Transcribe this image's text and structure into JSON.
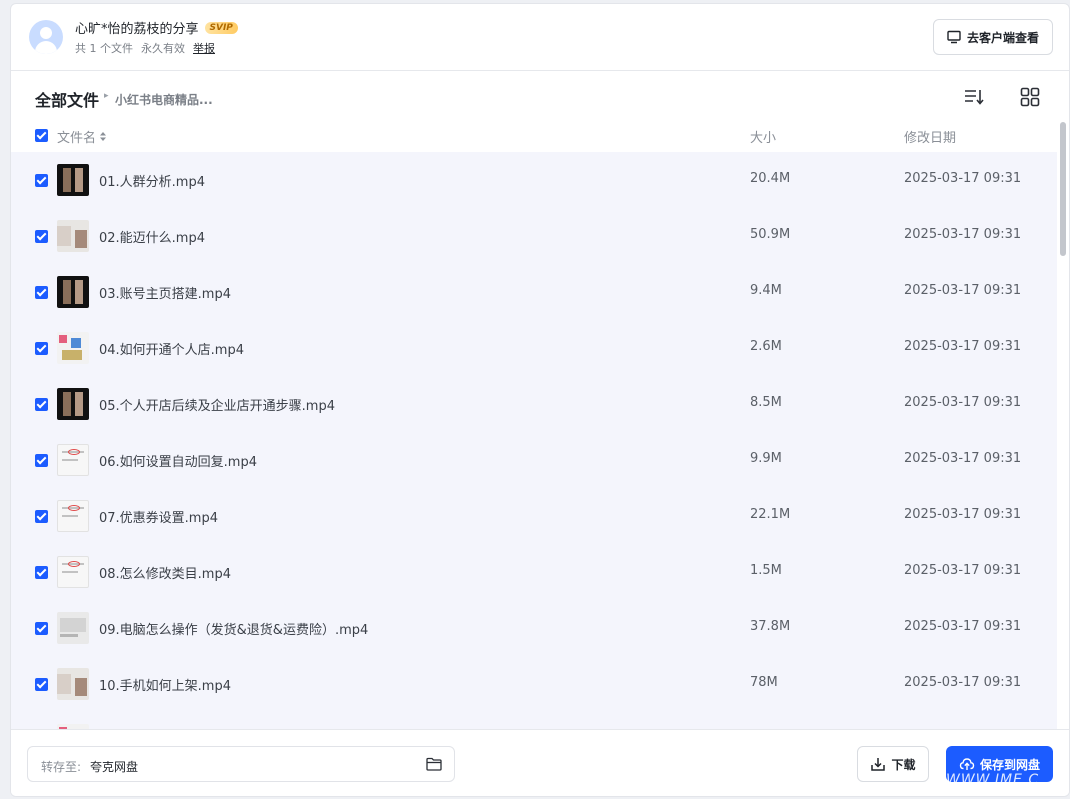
{
  "header": {
    "sharer_name": "心旷*怡的荔枝的分享",
    "vip_badge": "SVIP",
    "file_count": "共 1 个文件",
    "validity": "永久有效",
    "report_label": "举报",
    "client_button_label": "去客户端查看"
  },
  "breadcrumb": {
    "root": "全部文件",
    "current": "小红书电商精品..."
  },
  "table": {
    "columns": {
      "name": "文件名",
      "size": "大小",
      "date": "修改日期"
    },
    "rows": [
      {
        "name": "01.人群分析.mp4",
        "size": "20.4M",
        "date": "2025-03-17 09:31",
        "thumb": "t-dark"
      },
      {
        "name": "02.能迈什么.mp4",
        "size": "50.9M",
        "date": "2025-03-17 09:31",
        "thumb": "t-light"
      },
      {
        "name": "03.账号主页搭建.mp4",
        "size": "9.4M",
        "date": "2025-03-17 09:31",
        "thumb": "t-dark"
      },
      {
        "name": "04.如何开通个人店.mp4",
        "size": "2.6M",
        "date": "2025-03-17 09:31",
        "thumb": "t-mix"
      },
      {
        "name": "05.个人开店后续及企业店开通步骤.mp4",
        "size": "8.5M",
        "date": "2025-03-17 09:31",
        "thumb": "t-dark"
      },
      {
        "name": "06.如何设置自动回复.mp4",
        "size": "9.9M",
        "date": "2025-03-17 09:31",
        "thumb": "t-doc"
      },
      {
        "name": "07.优惠券设置.mp4",
        "size": "22.1M",
        "date": "2025-03-17 09:31",
        "thumb": "t-doc"
      },
      {
        "name": "08.怎么修改类目.mp4",
        "size": "1.5M",
        "date": "2025-03-17 09:31",
        "thumb": "t-doc"
      },
      {
        "name": "09.电脑怎么操作（发货&退货&运费险）.mp4",
        "size": "37.8M",
        "date": "2025-03-17 09:31",
        "thumb": "t-gray"
      },
      {
        "name": "10.手机如何上架.mp4",
        "size": "78M",
        "date": "2025-03-17 09:31",
        "thumb": "t-light"
      },
      {
        "name": "",
        "size": "",
        "date": "",
        "thumb": "t-mix"
      }
    ]
  },
  "footer": {
    "dest_label": "转存至:",
    "dest_value": "夸克网盘",
    "download_label": "下载",
    "save_label": "保存到网盘"
  },
  "watermark": "WWW.IME.C",
  "colors": {
    "accent": "#1c5cff",
    "list_bg": "#f4f5fc"
  }
}
